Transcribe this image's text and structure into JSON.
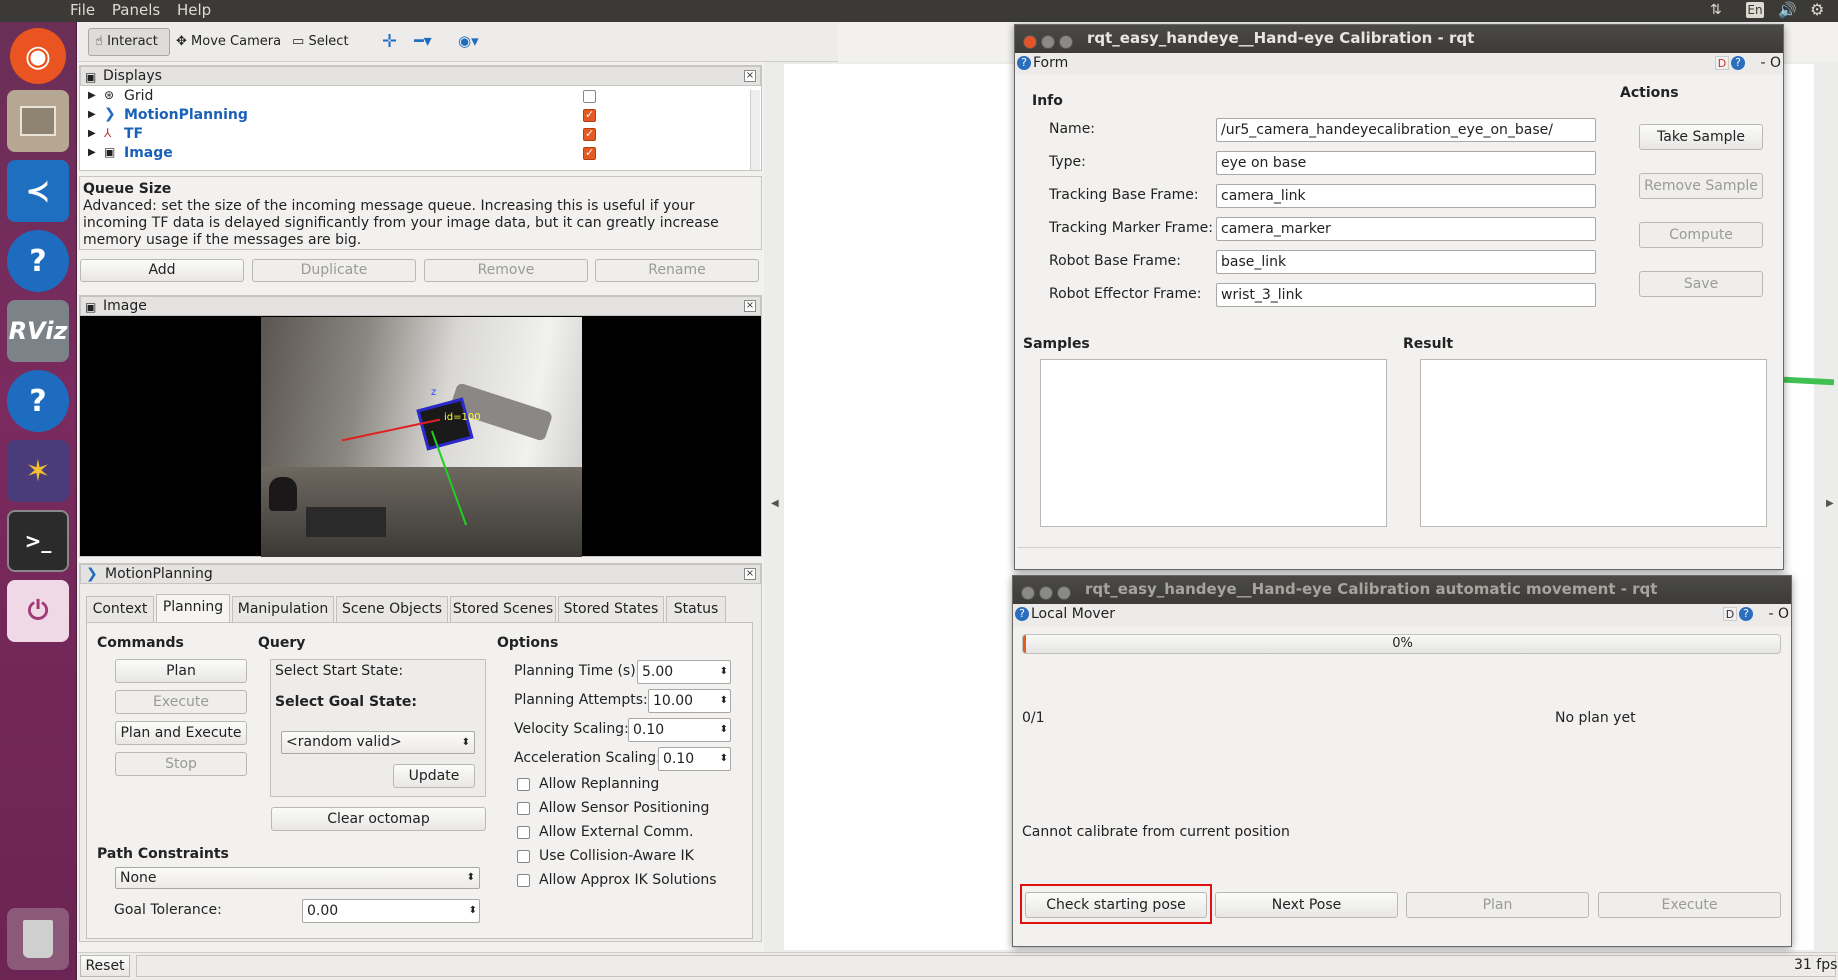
{
  "topbar": {
    "menus": [
      "File",
      "Panels",
      "Help"
    ],
    "indicators": [
      "sort-arrows-icon",
      "En",
      "volume-icon",
      "gear-icon"
    ]
  },
  "launcher": {
    "items": [
      "ubuntu-logo-icon",
      "files-icon",
      "vscode-icon",
      "help-icon",
      "RViz",
      "help-icon",
      "moveit-icon",
      "terminal-icon",
      "power-icon",
      "trash-icon"
    ],
    "rviz_label": "RViz",
    "help_label": "?"
  },
  "rviz": {
    "toolbar": {
      "interact": "Interact",
      "move_camera": "Move Camera",
      "select": "Select"
    },
    "displays": {
      "title": "Displays",
      "items": [
        {
          "label": "Grid",
          "checked": false
        },
        {
          "label": "MotionPlanning",
          "checked": true
        },
        {
          "label": "TF",
          "checked": true
        },
        {
          "label": "Image",
          "checked": true
        }
      ],
      "help_title": "Queue Size",
      "help_text": "Advanced: set the size of the incoming message queue. Increasing this is useful if your incoming TF data is delayed significantly from your image data, but it can greatly increase memory usage if the messages are big.",
      "buttons": {
        "add": "Add",
        "duplicate": "Duplicate",
        "remove": "Remove",
        "rename": "Rename"
      }
    },
    "image_panel": {
      "title": "Image",
      "marker_label": "id=100",
      "axis_label": "z"
    },
    "motion_planning": {
      "title": "MotionPlanning",
      "tabs": [
        "Context",
        "Planning",
        "Manipulation",
        "Scene Objects",
        "Stored Scenes",
        "Stored States",
        "Status"
      ],
      "active_tab": "Planning",
      "commands_title": "Commands",
      "commands": {
        "plan": "Plan",
        "execute": "Execute",
        "plan_and_execute": "Plan and Execute",
        "stop": "Stop"
      },
      "query_title": "Query",
      "select_start": "Select Start State:",
      "select_goal": "Select Goal State:",
      "goal_option": "<random valid>",
      "update": "Update",
      "clear_octomap": "Clear octomap",
      "options_title": "Options",
      "planning_time_label": "Planning Time (s):",
      "planning_time": "5.00",
      "planning_attempts_label": "Planning Attempts:",
      "planning_attempts": "10.00",
      "velocity_label": "Velocity Scaling:",
      "velocity": "0.10",
      "accel_label": "Acceleration Scaling:",
      "accel": "0.10",
      "checkboxes": [
        "Allow Replanning",
        "Allow Sensor Positioning",
        "Allow External Comm.",
        "Use Collision-Aware IK",
        "Allow Approx IK Solutions"
      ],
      "path_constraints_title": "Path Constraints",
      "path_constraint": "None",
      "goal_tolerance_label": "Goal Tolerance:",
      "goal_tolerance": "0.00"
    },
    "statusbar": {
      "reset": "Reset",
      "fps": "31 fps"
    }
  },
  "calib": {
    "window_title": "rqt_easy_handeye__Hand-eye Calibration - rqt",
    "form_label": "Form",
    "info_title": "Info",
    "actions_title": "Actions",
    "fields": [
      {
        "label": "Name:",
        "value": "/ur5_camera_handeyecalibration_eye_on_base/"
      },
      {
        "label": "Type:",
        "value": "eye on base"
      },
      {
        "label": "Tracking Base Frame:",
        "value": "camera_link"
      },
      {
        "label": "Tracking Marker Frame:",
        "value": "camera_marker"
      },
      {
        "label": "Robot Base Frame:",
        "value": "base_link"
      },
      {
        "label": "Robot Effector Frame:",
        "value": "wrist_3_link"
      }
    ],
    "actions": {
      "take_sample": "Take Sample",
      "remove_sample": "Remove Sample",
      "compute": "Compute",
      "save": "Save"
    },
    "samples_title": "Samples",
    "result_title": "Result",
    "header_controls": "D",
    "header_dash": "- O"
  },
  "mover": {
    "window_title": "rqt_easy_handeye__Hand-eye Calibration automatic movement - rqt",
    "plugin_label": "Local Mover",
    "progress": 0,
    "progress_text": "0%",
    "count": "0/1",
    "plan_status": "No plan yet",
    "message": "Cannot calibrate from current position",
    "buttons": {
      "check": "Check starting pose",
      "next": "Next Pose",
      "plan": "Plan",
      "execute": "Execute"
    },
    "highlight_color": "#e01010"
  }
}
